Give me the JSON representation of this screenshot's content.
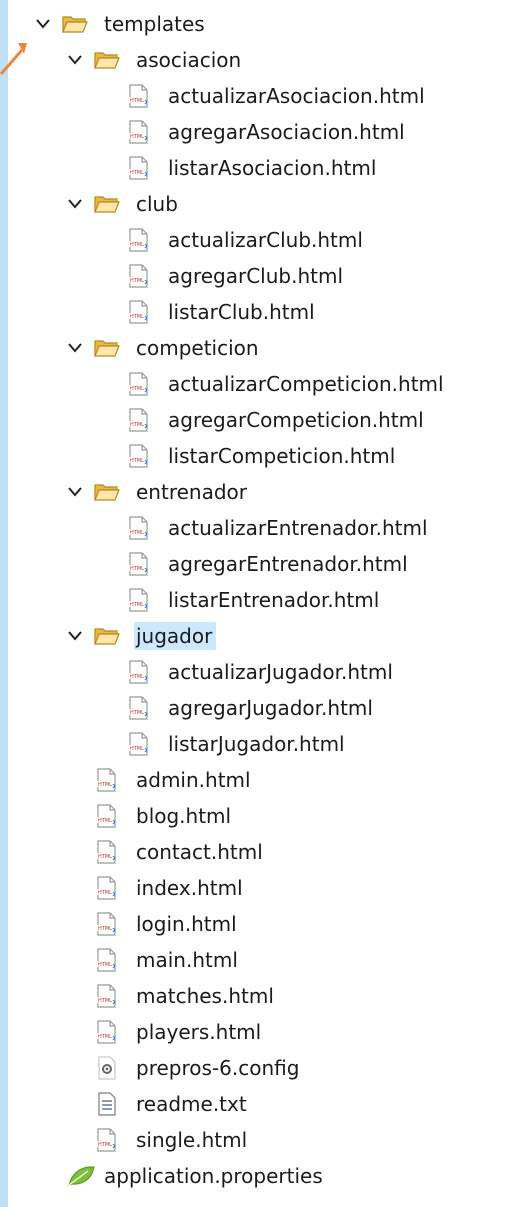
{
  "tree": [
    {
      "label": "templates",
      "type": "folder",
      "depth": 0,
      "expanded": true
    },
    {
      "label": "asociacion",
      "type": "folder",
      "depth": 1,
      "expanded": true
    },
    {
      "label": "actualizarAsociacion.html",
      "type": "html",
      "depth": 2
    },
    {
      "label": "agregarAsociacion.html",
      "type": "html",
      "depth": 2
    },
    {
      "label": "listarAsociacion.html",
      "type": "html",
      "depth": 2
    },
    {
      "label": "club",
      "type": "folder",
      "depth": 1,
      "expanded": true
    },
    {
      "label": "actualizarClub.html",
      "type": "html",
      "depth": 2
    },
    {
      "label": "agregarClub.html",
      "type": "html",
      "depth": 2
    },
    {
      "label": "listarClub.html",
      "type": "html",
      "depth": 2
    },
    {
      "label": "competicion",
      "type": "folder",
      "depth": 1,
      "expanded": true
    },
    {
      "label": "actualizarCompeticion.html",
      "type": "html",
      "depth": 2
    },
    {
      "label": "agregarCompeticion.html",
      "type": "html",
      "depth": 2
    },
    {
      "label": "listarCompeticion.html",
      "type": "html",
      "depth": 2
    },
    {
      "label": "entrenador",
      "type": "folder",
      "depth": 1,
      "expanded": true
    },
    {
      "label": "actualizarEntrenador.html",
      "type": "html",
      "depth": 2
    },
    {
      "label": "agregarEntrenador.html",
      "type": "html",
      "depth": 2
    },
    {
      "label": "listarEntrenador.html",
      "type": "html",
      "depth": 2
    },
    {
      "label": "jugador",
      "type": "folder",
      "depth": 1,
      "expanded": true,
      "selected": true
    },
    {
      "label": "actualizarJugador.html",
      "type": "html",
      "depth": 2
    },
    {
      "label": "agregarJugador.html",
      "type": "html",
      "depth": 2
    },
    {
      "label": "listarJugador.html",
      "type": "html",
      "depth": 2
    },
    {
      "label": "admin.html",
      "type": "html",
      "depth": 1
    },
    {
      "label": "blog.html",
      "type": "html",
      "depth": 1
    },
    {
      "label": "contact.html",
      "type": "html",
      "depth": 1
    },
    {
      "label": "index.html",
      "type": "html",
      "depth": 1
    },
    {
      "label": "login.html",
      "type": "html",
      "depth": 1
    },
    {
      "label": "main.html",
      "type": "html",
      "depth": 1
    },
    {
      "label": "matches.html",
      "type": "html",
      "depth": 1
    },
    {
      "label": "players.html",
      "type": "html",
      "depth": 1
    },
    {
      "label": "prepros-6.config",
      "type": "config",
      "depth": 1
    },
    {
      "label": "readme.txt",
      "type": "text",
      "depth": 1
    },
    {
      "label": "single.html",
      "type": "html",
      "depth": 1
    },
    {
      "label": "application.properties",
      "type": "properties",
      "depth": 0
    }
  ],
  "colors": {
    "folder": "#e8b948",
    "folder_stroke": "#b88a1c",
    "selected_bg": "#cce8ff",
    "arrow": "#e8883a",
    "properties_leaf": "#7cbf3a"
  }
}
